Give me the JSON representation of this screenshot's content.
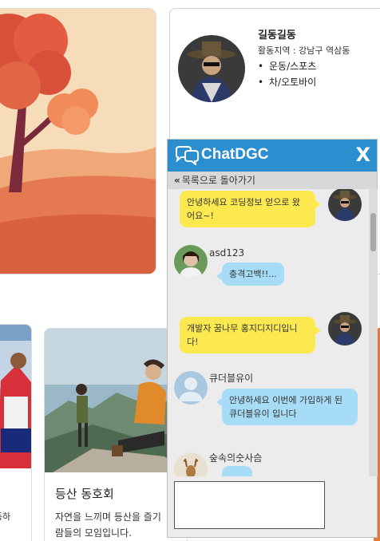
{
  "profile": {
    "name": "길동길동",
    "region": "활동지역 : 강남구 역삼동",
    "interests": [
      "운동/스포츠",
      "차/오토바이"
    ]
  },
  "clubs": {
    "left_partial_text": "동하",
    "hiking": {
      "title": "등산 동호회",
      "desc_line1": "자연을 느끼며 등산을 즐기",
      "desc_line2": "람들의 모임입니다."
    }
  },
  "chat": {
    "title": "ChatDGC",
    "close_label": "X",
    "back_label": "목록으로 돌아가기",
    "messages": [
      {
        "sender": "me",
        "text": "안녕하세요 코딩정보 얻으로 왔어요~!"
      },
      {
        "sender": "asd123",
        "text": "충격고백!!..."
      },
      {
        "sender": "me",
        "text": "개발자 꿈나무 홍지디지디입니다!"
      },
      {
        "sender": "큐더블유이",
        "text": "안녕하세요 이번에 가입하게 된 큐더블유이 입니다"
      },
      {
        "sender": "숲속의숫사슴",
        "text": ""
      }
    ],
    "input_value": ""
  },
  "colors": {
    "header_blue": "#2b8fcf",
    "my_bubble": "#fce94f",
    "their_bubble": "#a7dcf7"
  }
}
